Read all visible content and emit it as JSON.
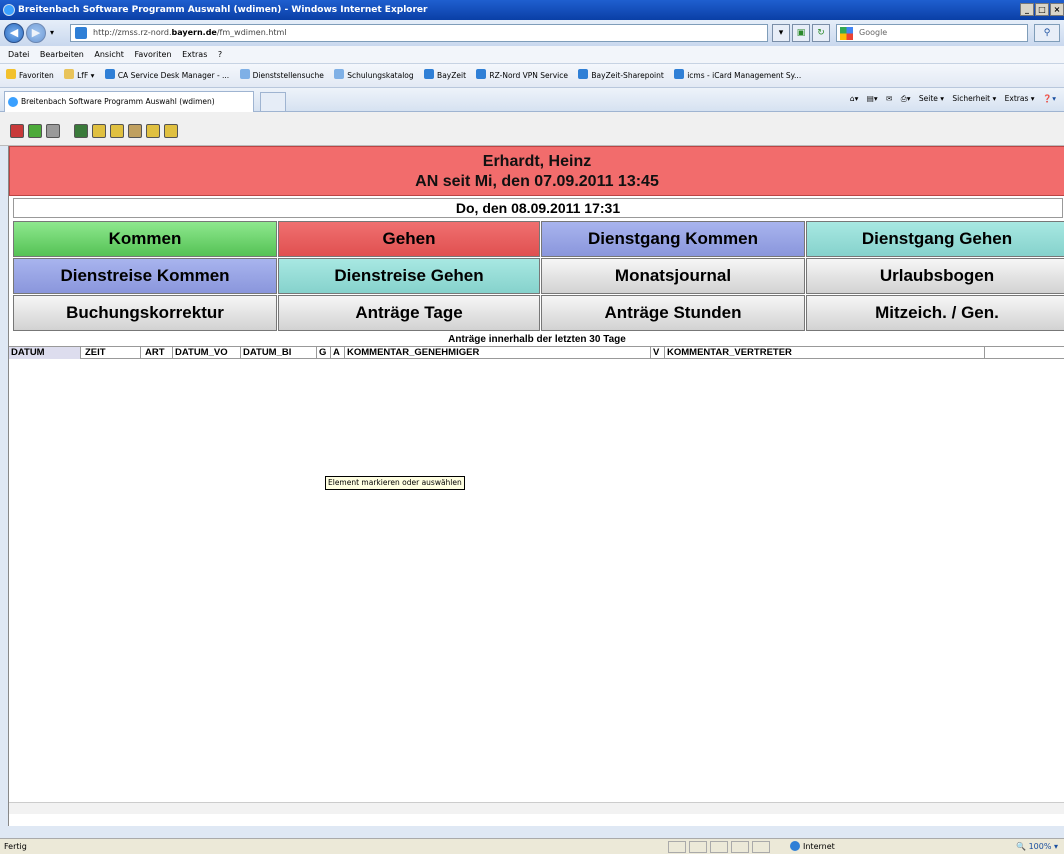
{
  "window": {
    "title": "Breitenbach Software Programm Auswahl (wdimen) - Windows Internet Explorer"
  },
  "address": {
    "prefix": "http://zmss.rz-nord.",
    "domain": "bayern.de",
    "path": "/fm_wdimen.html"
  },
  "search": {
    "placeholder": "Google"
  },
  "menu": [
    "Datei",
    "Bearbeiten",
    "Ansicht",
    "Favoriten",
    "Extras",
    "?"
  ],
  "favorites": {
    "label": "Favoriten",
    "items": [
      "LfF ▾",
      "CA Service Desk Manager - ...",
      "Dienststellensuche",
      "Schulungskatalog",
      "BayZeit",
      "RZ-Nord VPN Service",
      "BayZeit-Sharepoint",
      "icms - iCard Management Sy..."
    ]
  },
  "tab": {
    "label": "Breitenbach Software Programm Auswahl (wdimen)"
  },
  "cmdbar": [
    "Seite ▾",
    "Sicherheit ▾",
    "Extras ▾"
  ],
  "app": {
    "name": "Erhardt, Heinz",
    "status": "AN seit Mi, den 07.09.2011 13:45",
    "current_date": "Do, den 08.09.2011 17:31",
    "buttons": [
      {
        "label": "Kommen",
        "color": "#55c255"
      },
      {
        "label": "Gehen",
        "color": "#e05050"
      },
      {
        "label": "Dienstgang Kommen",
        "color": "#8a96dc"
      },
      {
        "label": "Dienstgang Gehen",
        "color": "#86d2cc"
      },
      {
        "label": "Dienstreise Kommen",
        "color": "#8a96dc"
      },
      {
        "label": "Dienstreise Gehen",
        "color": "#86d2cc"
      },
      {
        "label": "Monatsjournal",
        "color": "#d2d2d2"
      },
      {
        "label": "Urlaubsbogen",
        "color": "#d2d2d2"
      },
      {
        "label": "Buchungskorrektur",
        "color": "#d2d2d2"
      },
      {
        "label": "Anträge Tage",
        "color": "#d2d2d2"
      },
      {
        "label": "Anträge Stunden",
        "color": "#d2d2d2"
      },
      {
        "label": "Mitzeich. / Gen.",
        "color": "#d2d2d2"
      }
    ],
    "list_title": "Anträge innerhalb der letzten 30 Tage",
    "columns": [
      "DATUM",
      "ZEIT",
      "ART",
      "DATUM_VO",
      "DATUM_BI",
      "G",
      "A",
      "KOMMENTAR_GENEHMIGER",
      "V",
      "KOMMENTAR_VERTRETER"
    ],
    "tooltip": "Element markieren oder auswählen"
  },
  "status": {
    "text": "Fertig",
    "zone": "Internet",
    "zoom": "100%"
  }
}
